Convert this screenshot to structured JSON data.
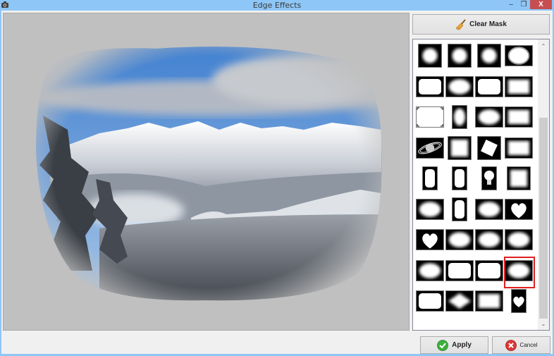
{
  "window": {
    "title": "Edge Effects",
    "minimize_glyph": "–",
    "maximize_glyph": "❐",
    "close_glyph": "X"
  },
  "canvas": {
    "description": "Winter mountain landscape photo with soft vignette edge mask applied",
    "background_color": "#c0c0c0"
  },
  "panel": {
    "clear_mask_label": "Clear Mask",
    "clear_mask_icon": "broom-icon",
    "selected_index": 31,
    "masks": [
      {
        "name": "soft-circle-1"
      },
      {
        "name": "soft-circle-2"
      },
      {
        "name": "rough-circle"
      },
      {
        "name": "oval-ring"
      },
      {
        "name": "rounded-rect"
      },
      {
        "name": "scalloped-oval"
      },
      {
        "name": "wavy-rect"
      },
      {
        "name": "soft-rect"
      },
      {
        "name": "corner-marks"
      },
      {
        "name": "splatter-oval"
      },
      {
        "name": "swirl-oval"
      },
      {
        "name": "ornate-frame"
      },
      {
        "name": "planet-rings"
      },
      {
        "name": "torn-square"
      },
      {
        "name": "tilted-square"
      },
      {
        "name": "square-frame"
      },
      {
        "name": "scribble"
      },
      {
        "name": "torn-portrait"
      },
      {
        "name": "lightbulb"
      },
      {
        "name": "torn-square-2"
      },
      {
        "name": "starburst"
      },
      {
        "name": "soft-portrait"
      },
      {
        "name": "curly-oval"
      },
      {
        "name": "heart"
      },
      {
        "name": "double-heart"
      },
      {
        "name": "swirl-burst"
      },
      {
        "name": "zigzag-oval"
      },
      {
        "name": "splat"
      },
      {
        "name": "swoosh-oval"
      },
      {
        "name": "jagged-rect"
      },
      {
        "name": "notched-rect"
      },
      {
        "name": "soft-blob"
      },
      {
        "name": "brush-rect"
      },
      {
        "name": "diamond"
      },
      {
        "name": "thin-frame"
      },
      {
        "name": "heart-portrait"
      }
    ]
  },
  "scroll": {
    "position_fraction": 0.25,
    "visible_fraction": 0.75,
    "up_glyph": "⌃",
    "down_glyph": "⌄"
  },
  "footer": {
    "apply_label": "Apply",
    "cancel_label": "Cancel"
  },
  "colors": {
    "frame": "#8ec6f7",
    "close": "#c74e50",
    "selection": "#e02020",
    "apply_green": "#3cae3c",
    "cancel_red": "#d93838"
  }
}
